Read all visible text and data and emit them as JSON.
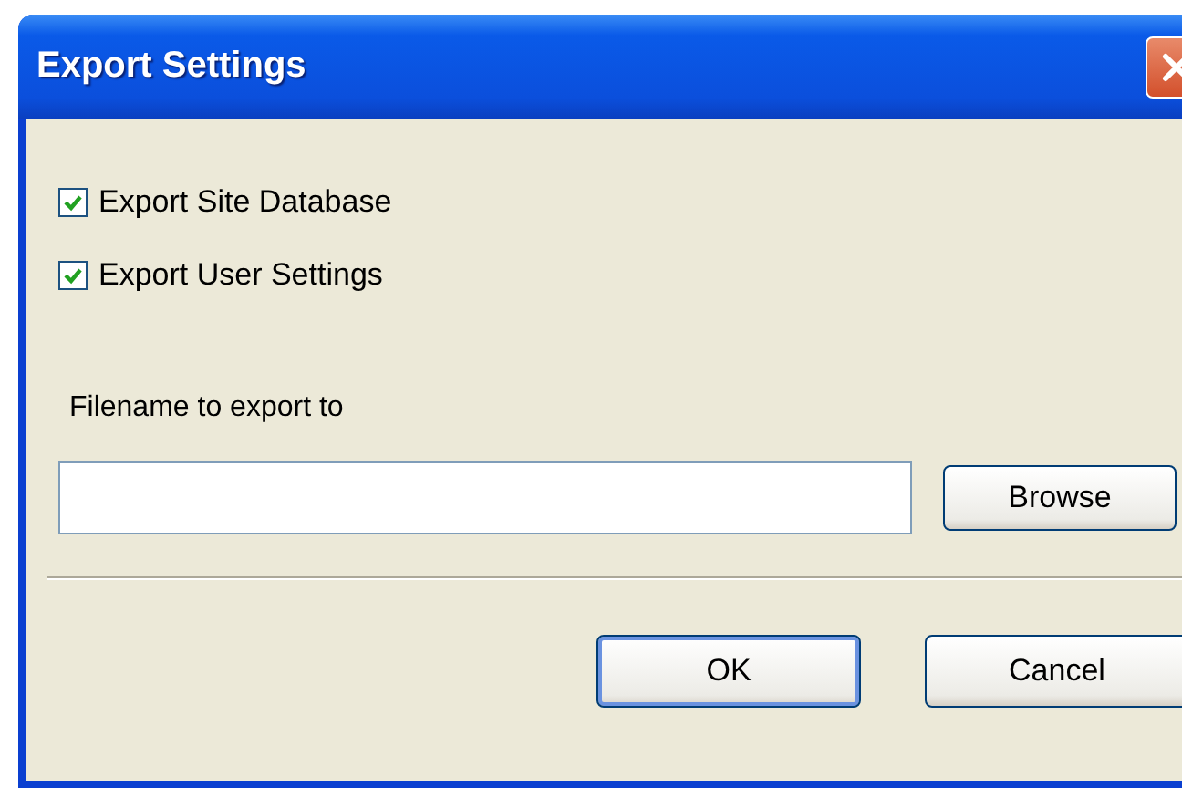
{
  "window": {
    "title": "Export Settings"
  },
  "options": [
    {
      "label": "Export Site Database",
      "checked": true
    },
    {
      "label": "Export User Settings",
      "checked": true
    }
  ],
  "filename": {
    "label": "Filename to export to",
    "browse_button": "Browse"
  },
  "buttons": [
    {
      "label": "OK",
      "default": true
    },
    {
      "label": "Cancel",
      "default": false
    }
  ]
}
